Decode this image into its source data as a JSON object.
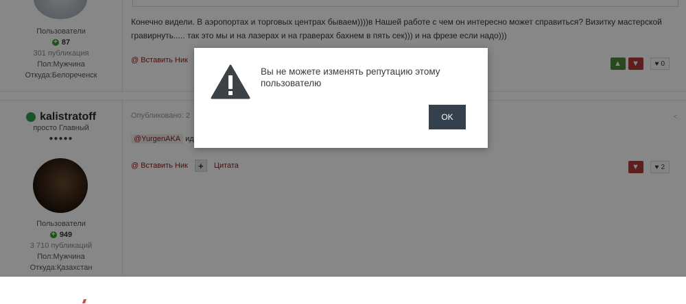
{
  "post1": {
    "author": {
      "group": "Пользователи",
      "reputation": "87",
      "posts": "301 публикация",
      "gender": "Пол:Мужчина",
      "location": "Откуда:Белореченск"
    },
    "text": "Конечно видели. В аэропортах и торговых центрах бываем))))в Нашей работе с чем он интересно может справиться? Визитку мастерской гравирнуть..... так это мы и на лазерах и на граверах бахнем в пять сек))) и на фрезе если надо)))",
    "actions": {
      "insert_nick": "@ Вставить Ник"
    },
    "like_count": "0"
  },
  "post2": {
    "author": {
      "name": "kalistratoff",
      "title": "просто Главный",
      "pips": "●●●●●",
      "group": "Пользователи",
      "reputation": "949",
      "posts": "3 710 публикаций",
      "gender": "Пол:Мужчина",
      "location": "Откуда:Қазахстан"
    },
    "published": "Опубликовано: 2",
    "mention": "@YurgenAKA",
    "mention_rest": "ид",
    "actions": {
      "insert_nick": "@ Вставить Ник",
      "plus": "+",
      "quote": "Цитата"
    },
    "like_count": "2"
  },
  "dialog": {
    "message": "Вы не можете изменять репутацию этому пользователю",
    "ok_label": "OK",
    "icon": "warning-icon"
  },
  "colors": {
    "overlay": "rgba(0,0,0,0.47)",
    "ok_button": "#34404c",
    "upvote": "#4d8a3b",
    "downvote": "#b13a3a",
    "link": "#8c1a1a",
    "online": "#2e9e4f"
  }
}
